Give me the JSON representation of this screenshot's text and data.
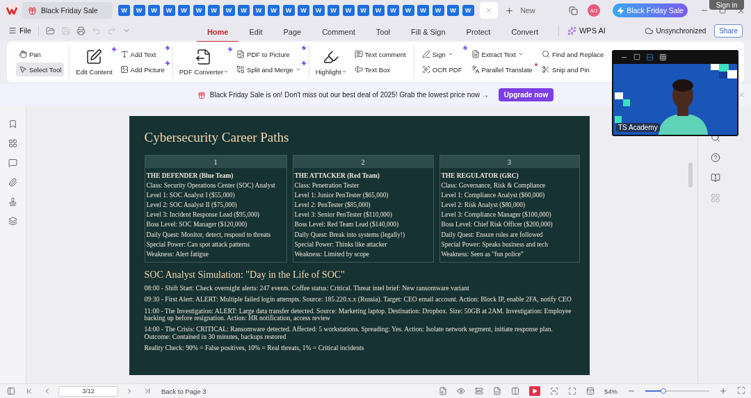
{
  "title_bar": {
    "promo_tab": "Black Friday Sale",
    "doc_tabs": [
      {
        "letter": "W"
      },
      {
        "letter": "W"
      },
      {
        "letter": "W"
      },
      {
        "letter": "W"
      },
      {
        "letter": "W"
      },
      {
        "letter": "W"
      },
      {
        "letter": "W"
      },
      {
        "letter": "W"
      },
      {
        "letter": "W"
      },
      {
        "letter": "W"
      },
      {
        "letter": "W"
      },
      {
        "letter": "W"
      },
      {
        "letter": "W"
      },
      {
        "letter": "W"
      },
      {
        "letter": "W"
      },
      {
        "letter": "W"
      },
      {
        "letter": "W"
      },
      {
        "letter": "W"
      },
      {
        "letter": "W"
      },
      {
        "letter": "W"
      },
      {
        "letter": "W"
      },
      {
        "letter": "W"
      },
      {
        "letter": "W"
      },
      {
        "letter": "W"
      }
    ],
    "new_label": "New",
    "avatar": "AO",
    "promo_button": "Black Friday Sale",
    "tooltip": "Sign in"
  },
  "menu": {
    "file": "File",
    "tabs": [
      {
        "label": "Home",
        "selected": true
      },
      {
        "label": "Edit",
        "selected": false
      },
      {
        "label": "Page",
        "selected": false
      },
      {
        "label": "Comment",
        "selected": false
      },
      {
        "label": "Tool",
        "selected": false
      },
      {
        "label": "Fill & Sign",
        "selected": false
      },
      {
        "label": "Protect",
        "selected": false
      },
      {
        "label": "Convert",
        "selected": false
      }
    ],
    "ai": "WPS AI",
    "sync": "Unsynchronized",
    "share": "Share"
  },
  "ribbon": [
    {
      "columns": [
        [
          {
            "label": "Pan",
            "kind": "small",
            "selected": false,
            "new": false,
            "dropdown": false,
            "dot": false
          },
          {
            "label": "Select Tool",
            "kind": "small",
            "selected": true,
            "new": false,
            "dropdown": false,
            "dot": false
          }
        ]
      ]
    },
    {
      "columns": [
        [
          {
            "label": "Edit Content",
            "kind": "large",
            "selected": false,
            "new": true,
            "dropdown": false,
            "dot": false
          }
        ],
        [
          {
            "label": "Add Text",
            "kind": "small",
            "selected": false,
            "new": true,
            "dropdown": false,
            "dot": false
          },
          {
            "label": "Add Picture",
            "kind": "small",
            "selected": false,
            "new": true,
            "dropdown": false,
            "dot": false
          }
        ]
      ]
    },
    {
      "columns": [
        [
          {
            "label": "PDF Converter",
            "kind": "large",
            "selected": false,
            "new": true,
            "dropdown": true,
            "dot": false
          }
        ],
        [
          {
            "label": "PDF to Picture",
            "kind": "small",
            "selected": false,
            "new": true,
            "dropdown": false,
            "dot": false
          },
          {
            "label": "Split and Merge",
            "kind": "small",
            "selected": false,
            "new": true,
            "dropdown": true,
            "dot": false
          }
        ]
      ]
    },
    {
      "columns": [
        [
          {
            "label": "Highlight",
            "kind": "large",
            "selected": false,
            "new": false,
            "dropdown": true,
            "dot": false
          }
        ],
        [
          {
            "label": "Text comment",
            "kind": "small",
            "selected": false,
            "new": false,
            "dropdown": false,
            "dot": false
          },
          {
            "label": "Text Box",
            "kind": "small",
            "selected": false,
            "new": false,
            "dropdown": false,
            "dot": false
          }
        ]
      ]
    },
    {
      "columns": [
        [
          {
            "label": "Sign",
            "kind": "small",
            "selected": false,
            "new": true,
            "dropdown": true,
            "dot": false
          },
          {
            "label": "OCR PDF",
            "kind": "small",
            "selected": false,
            "new": false,
            "dropdown": false,
            "dot": false
          }
        ],
        [
          {
            "label": "Extract Text",
            "kind": "small",
            "selected": false,
            "new": false,
            "dropdown": true,
            "dot": false
          },
          {
            "label": "Parallel Translate",
            "kind": "small",
            "selected": false,
            "new": false,
            "dropdown": false,
            "dot": true
          }
        ],
        [
          {
            "label": "Find and Replace",
            "kind": "small",
            "selected": false,
            "new": false,
            "dropdown": false,
            "dot": false
          },
          {
            "label": "Snip and Pin",
            "kind": "small",
            "selected": false,
            "new": false,
            "dropdown": false,
            "dot": false
          }
        ]
      ]
    }
  ],
  "banner": {
    "text": "Black Friday Sale is on! Don't miss out our best deal of 2025! Grab the lowest price now →",
    "button": "Upgrade now"
  },
  "document": {
    "title": "Cybersecurity Career Paths",
    "table": {
      "columns": [
        {
          "header": "1",
          "lines": [
            "THE DEFENDER (Blue Team)",
            "Class: Security Operations Center (SOC) Analyst",
            "Level 1: SOC Analyst I ($55,000)",
            "Level 2: SOC Analyst II ($75,000)",
            "Level 3: Incident Response Lead ($95,000)",
            "Boss Level: SOC Manager ($120,000)",
            "Daily Quest: Monitor, detect, respond to threats",
            "Special Power: Can spot attack patterns",
            "Weakness: Alert fatigue"
          ]
        },
        {
          "header": "2",
          "lines": [
            "THE ATTACKER (Red Team)",
            "Class: Penetration Tester",
            "Level 1: Junior PenTester ($65,000)",
            "Level 2: PenTester ($85,000)",
            "Level 3: Senior PenTester ($110,000)",
            "Boss Level: Red Team Lead ($140,000)",
            "Daily Quest: Break into systems (legally!)",
            "Special Power: Thinks like attacker",
            "Weakness: Limited by scope"
          ]
        },
        {
          "header": "3",
          "lines": [
            "THE REGULATOR (GRC)",
            "Class: Governance, Risk & Compliance",
            "Level 1: Compliance Analyst ($60,000)",
            "Level 2: Risk Analyst ($80,000)",
            "Level 3: Compliance Manager ($100,000)",
            "Boss Level: Chief Risk Officer ($200,000)",
            "Daily Quest: Ensure rules are followed",
            "Special Power: Speaks business and tech",
            "Weakness: Seen as \"fun police\""
          ]
        }
      ]
    },
    "section_title": "SOC Analyst Simulation: \"Day in the Life of SOC\"",
    "paragraphs": [
      "08:00 - Shift Start: Check overnight alerts: 247 events. Coffee status: Critical. Threat intel brief: New ransomware variant",
      "09:30 - First Alert: ALERT: Multiple failed login attempts. Source: 185.220.x.x (Russia). Target: CEO email account. Action: Block IP, enable 2FA, notify CEO",
      "11:00 - The Investigation: ALERT: Large data transfer detected. Source: Marketing laptop. Destination: Dropbox. Size: 50GB at 2AM. Investigation: Employee backing up before resignation. Action: HR notification, access review",
      "14:00 - The Crisis: CRITICAL: Ransomware detected. Affected: 5 workstations. Spreading: Yes. Action: Isolate network segment, initiate response plan. Outcome: Contained in 30 minutes, backups restored",
      "Reality Check: 90% = False positives, 10% = Real threats, 1% = Critical incidents"
    ]
  },
  "video": {
    "name_tag": "TS Academy"
  },
  "status_bar": {
    "page_field": "3/12",
    "back_link": "Back to Page 3",
    "zoom": "54%",
    "zoom_slider": {
      "level": 0.28
    }
  }
}
